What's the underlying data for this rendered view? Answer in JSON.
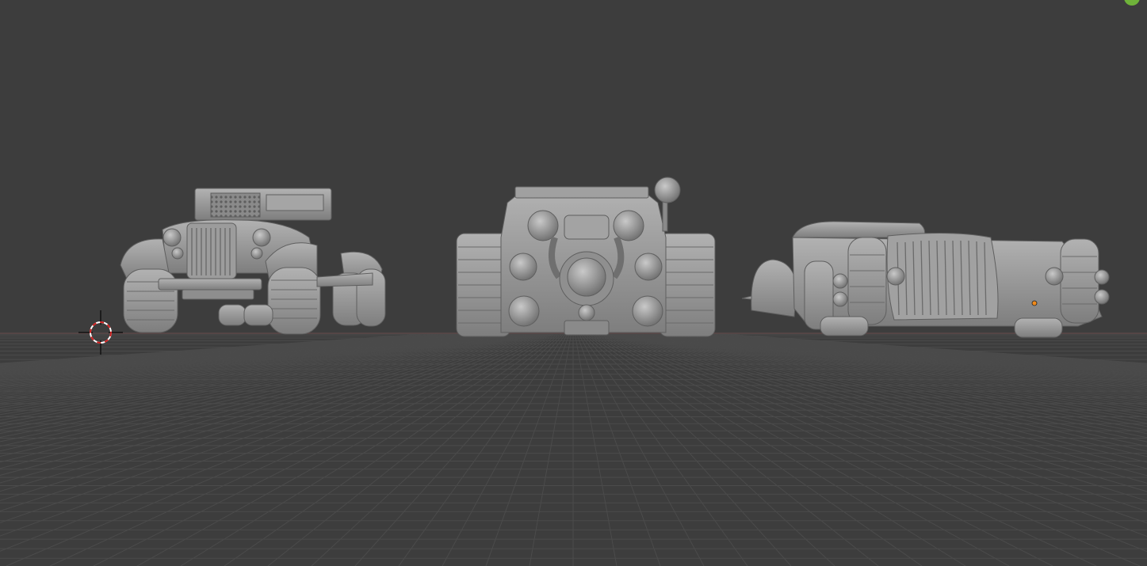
{
  "app": {
    "name": "3D viewport"
  },
  "viewport": {
    "background": "#3d3d3d",
    "grid_color": "#4b4b4b",
    "horizon_color": "#5a4646",
    "model_color": "#9a9a9a",
    "accent_gizmo_color": "#6fb33a",
    "origin_dot_color": "#f08a1a"
  },
  "objects": [
    {
      "name": "truck-front",
      "icon": "truck-model"
    },
    {
      "name": "tank-front",
      "icon": "tracked-vehicle-model"
    },
    {
      "name": "hotrod-side",
      "icon": "hotrod-model"
    }
  ],
  "cursor": {
    "icon": "3d-cursor-icon"
  }
}
